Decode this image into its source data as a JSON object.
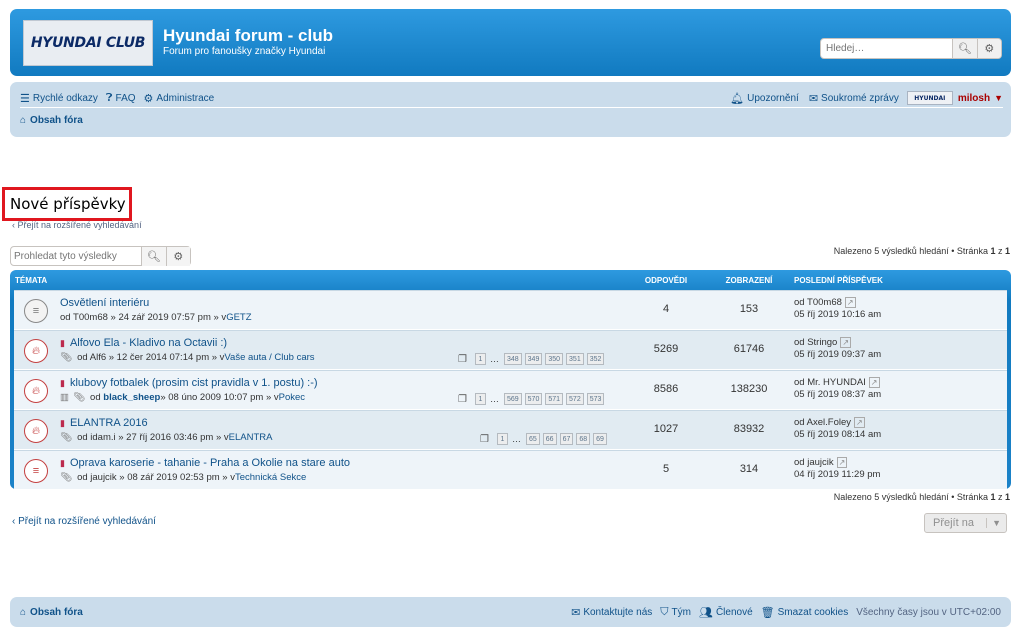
{
  "header": {
    "logo_text": "HYUNDAI CLUB",
    "site_title": "Hyundai forum - club",
    "site_description": "Forum pro fanoušky značky Hyundai",
    "search_placeholder": "Hledej…"
  },
  "navbar": {
    "quick_links": "Rychlé odkazy",
    "faq": "FAQ",
    "admin": "Administrace",
    "notifications": "Upozornění",
    "private_messages": "Soukromé zprávy",
    "user_logo_text": "HYUNDAI",
    "username": "milosh",
    "breadcrumb": "Obsah fóra"
  },
  "page": {
    "title": "Nové příspěvky",
    "advanced_search_link": "Přejít na rozšířené vyhledávání",
    "search_results_placeholder": "Prohledat tyto výsledky",
    "pagination": {
      "prefix": "Nalezeno 5 výsledků hledání • Stránka ",
      "current": "1",
      "sep": " z ",
      "total": "1"
    }
  },
  "table": {
    "headers": {
      "topics": "Témata",
      "replies": "Odpovědi",
      "views": "Zobrazení",
      "last_post": "Poslední příspěvek"
    },
    "rows": [
      {
        "icon": "topic-read-icon",
        "title": "Osvětlení interiéru",
        "meta": "od T00m68 » 24 zář 2019 07:57 pm » v ",
        "forum": "GETZ",
        "replies": "4",
        "views": "153",
        "last_by": "od T00m68",
        "last_date": "05 říj 2019 10:16 am",
        "pages": []
      },
      {
        "icon": "hot-topic-icon",
        "title": "Alfovo Ela - Kladivo na Octavii :)",
        "meta": "od Alf6 » 12 čer 2014 07:14 pm » v ",
        "forum": "Vaše auta / Club cars",
        "replies": "5269",
        "views": "61746",
        "last_by": "od Stringo",
        "last_date": "05 říj 2019 09:37 am",
        "pages": [
          "1",
          "348",
          "349",
          "350",
          "351",
          "352"
        ]
      },
      {
        "icon": "hot-topic-icon",
        "title": "klubovy fotbalek (prosim cist pravidla v 1. postu) :-)",
        "meta_prefix": "od ",
        "author_bold": "black_sheep",
        "meta": " » 08 úno 2009 10:07 pm » v ",
        "forum": "Pokec",
        "replies": "8586",
        "views": "138230",
        "last_by": "od Mr. HYUNDAI",
        "last_date": "05 říj 2019 08:37 am",
        "pages": [
          "1",
          "569",
          "570",
          "571",
          "572",
          "573"
        ]
      },
      {
        "icon": "hot-topic-icon",
        "title": "ELANTRA 2016",
        "meta": "od idam.i » 27 říj 2016 03:46 pm » v ",
        "forum": "ELANTRA",
        "replies": "1027",
        "views": "83932",
        "last_by": "od Axel.Foley",
        "last_date": "05 říj 2019 08:14 am",
        "pages": [
          "1",
          "65",
          "66",
          "67",
          "68",
          "69"
        ]
      },
      {
        "icon": "hot-topic-icon",
        "title": "Oprava karoserie - tahanie - Praha a Okolie na stare auto",
        "meta": "od jaujcik » 08 zář 2019 02:53 pm » v ",
        "forum": "Technická Sekce",
        "replies": "5",
        "views": "314",
        "last_by": "od jaujcik",
        "last_date": "04 říj 2019 11:29 pm",
        "pages": []
      }
    ]
  },
  "jump_button": "Přejít na",
  "footer": {
    "breadcrumb": "Obsah fóra",
    "contact": "Kontaktujte nás",
    "team": "Tým",
    "members": "Členové",
    "delete_cookies": "Smazat cookies",
    "timezone": "Všechny časy jsou v UTC+02:00"
  },
  "colors": {
    "header_blue": "#1b82c8",
    "nav_bg": "#cadceb",
    "link": "#105289",
    "username": "#aa0000",
    "highlight_border": "#e0171f"
  }
}
